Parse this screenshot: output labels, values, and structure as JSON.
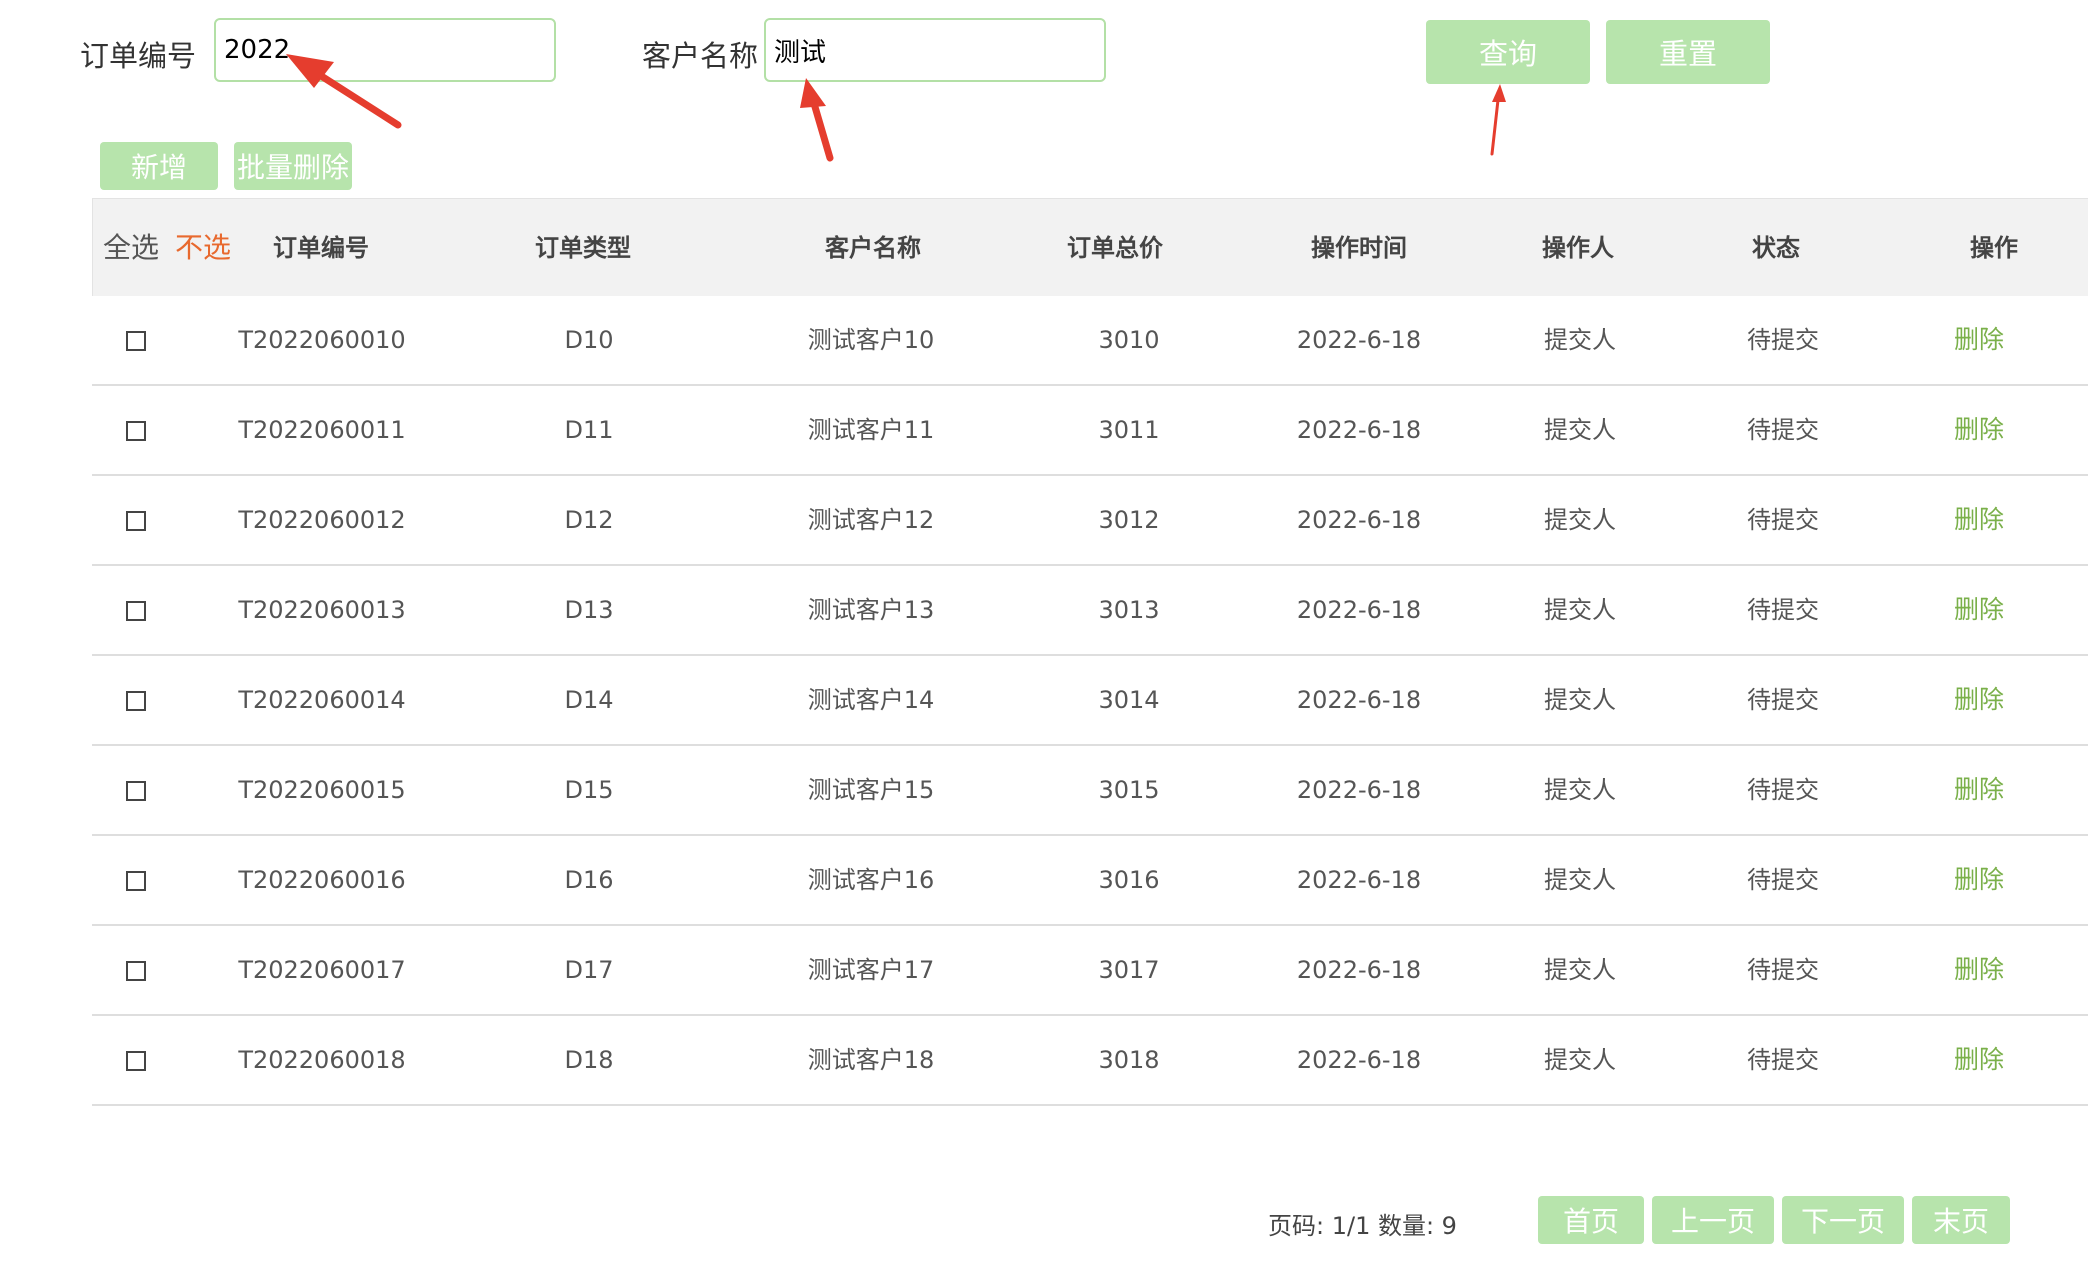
{
  "search": {
    "order_no_label": "订单编号",
    "order_no_value": "2022",
    "customer_label": "客户名称",
    "customer_value": "测试",
    "query_label": "查询",
    "reset_label": "重置"
  },
  "toolbar": {
    "add_label": "新增",
    "batch_delete_label": "批量删除"
  },
  "table": {
    "select_all": "全选",
    "select_none": "不选",
    "headers": {
      "order_no": "订单编号",
      "order_type": "订单类型",
      "customer": "客户名称",
      "total": "订单总价",
      "time": "操作时间",
      "operator": "操作人",
      "status": "状态",
      "action": "操作"
    },
    "rows": [
      {
        "order_no": "T2022060010",
        "type": "D10",
        "customer": "测试客户10",
        "total": "3010",
        "time": "2022-6-18",
        "operator": "提交人",
        "status": "待提交",
        "action": "删除"
      },
      {
        "order_no": "T2022060011",
        "type": "D11",
        "customer": "测试客户11",
        "total": "3011",
        "time": "2022-6-18",
        "operator": "提交人",
        "status": "待提交",
        "action": "删除"
      },
      {
        "order_no": "T2022060012",
        "type": "D12",
        "customer": "测试客户12",
        "total": "3012",
        "time": "2022-6-18",
        "operator": "提交人",
        "status": "待提交",
        "action": "删除"
      },
      {
        "order_no": "T2022060013",
        "type": "D13",
        "customer": "测试客户13",
        "total": "3013",
        "time": "2022-6-18",
        "operator": "提交人",
        "status": "待提交",
        "action": "删除"
      },
      {
        "order_no": "T2022060014",
        "type": "D14",
        "customer": "测试客户14",
        "total": "3014",
        "time": "2022-6-18",
        "operator": "提交人",
        "status": "待提交",
        "action": "删除"
      },
      {
        "order_no": "T2022060015",
        "type": "D15",
        "customer": "测试客户15",
        "total": "3015",
        "time": "2022-6-18",
        "operator": "提交人",
        "status": "待提交",
        "action": "删除"
      },
      {
        "order_no": "T2022060016",
        "type": "D16",
        "customer": "测试客户16",
        "total": "3016",
        "time": "2022-6-18",
        "operator": "提交人",
        "status": "待提交",
        "action": "删除"
      },
      {
        "order_no": "T2022060017",
        "type": "D17",
        "customer": "测试客户17",
        "total": "3017",
        "time": "2022-6-18",
        "operator": "提交人",
        "status": "待提交",
        "action": "删除"
      },
      {
        "order_no": "T2022060018",
        "type": "D18",
        "customer": "测试客户18",
        "total": "3018",
        "time": "2022-6-18",
        "operator": "提交人",
        "status": "待提交",
        "action": "删除"
      }
    ]
  },
  "pager": {
    "info": "页码: 1/1 数量: 9",
    "first": "首页",
    "prev": "上一页",
    "next": "下一页",
    "last": "末页"
  },
  "colors": {
    "button_bg": "#b7e4ac",
    "input_border": "#b3e0a6",
    "delete_link": "#7ab04a",
    "select_none": "#e8692e",
    "arrow": "#e53d2e"
  }
}
